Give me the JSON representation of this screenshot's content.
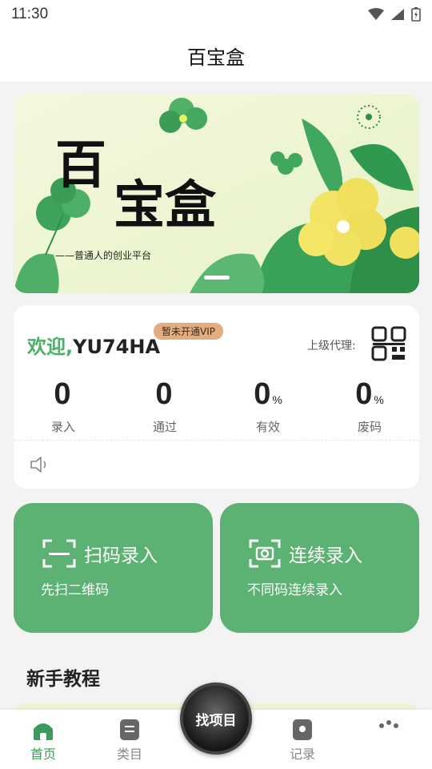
{
  "status_bar": {
    "time": "11:30"
  },
  "header": {
    "title": "百宝盒"
  },
  "banner": {
    "title_line1": "百",
    "title_line2": "宝盒",
    "slogan": "——普通人的创业平台"
  },
  "profile": {
    "welcome_prefix": "欢迎,",
    "username": "YU74HA",
    "vip_badge": "暂未开通VIP",
    "superior_label": "上级代理:"
  },
  "stats": [
    {
      "value": "0",
      "unit": "",
      "label": "录入"
    },
    {
      "value": "0",
      "unit": "",
      "label": "通过"
    },
    {
      "value": "0",
      "unit": "%",
      "label": "有效"
    },
    {
      "value": "0",
      "unit": "%",
      "label": "废码"
    }
  ],
  "actions": {
    "scan": {
      "title": "扫码录入",
      "subtitle": "先扫二维码"
    },
    "continuous": {
      "title": "连续录入",
      "subtitle": "不同码连续录入"
    }
  },
  "tutorial": {
    "title": "新手教程"
  },
  "tabbar": {
    "home": "首页",
    "category": "类目",
    "center": "找项目",
    "records": "记录",
    "more": ""
  },
  "colors": {
    "accent": "#5bb272",
    "accent_text": "#4caf6a",
    "vip": "#e3ad7f"
  }
}
